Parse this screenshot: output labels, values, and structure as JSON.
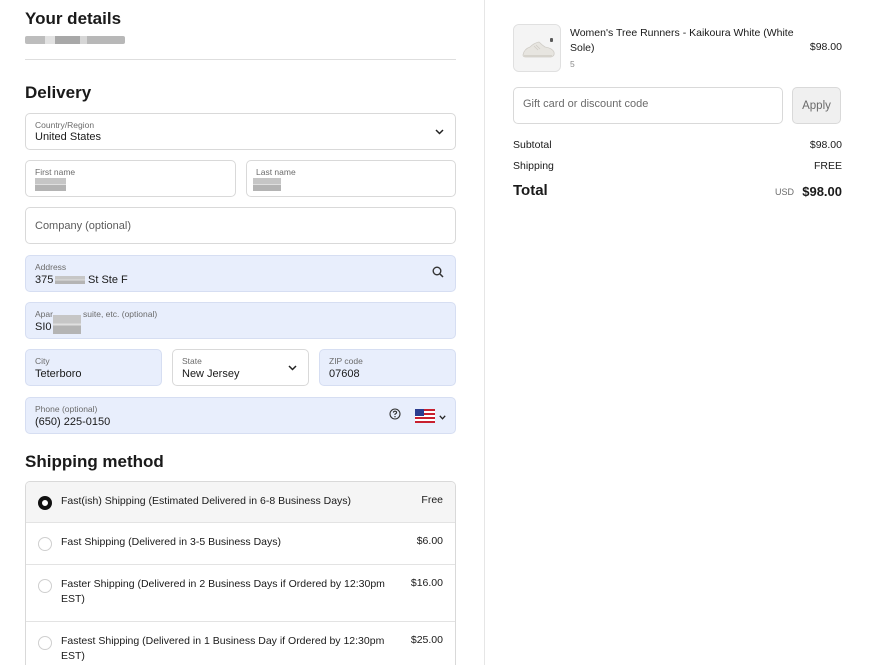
{
  "details": {
    "title": "Your details"
  },
  "delivery": {
    "title": "Delivery",
    "country": {
      "label": "Country/Region",
      "value": "United States"
    },
    "first_name": {
      "label": "First name"
    },
    "last_name": {
      "label": "Last name"
    },
    "company": {
      "placeholder": "Company (optional)"
    },
    "address": {
      "label": "Address",
      "value_prefix": "375",
      "value_suffix": "St Ste F"
    },
    "apartment": {
      "label_prefix": "Apar",
      "label_suffix": "suite, etc. (optional)",
      "value_prefix": "SI0"
    },
    "city": {
      "label": "City",
      "value": "Teterboro"
    },
    "state": {
      "label": "State",
      "value": "New Jersey"
    },
    "zip": {
      "label": "ZIP code",
      "value": "07608"
    },
    "phone": {
      "label": "Phone (optional)",
      "value": "(650) 225-0150",
      "country_flag": "us-flag-icon"
    }
  },
  "shipping": {
    "title": "Shipping method",
    "options": [
      {
        "label": "Fast(ish) Shipping (Estimated Delivered in 6-8 Business Days)",
        "price": "Free",
        "selected": true
      },
      {
        "label": "Fast Shipping (Delivered in 3-5 Business Days)",
        "price": "$6.00",
        "selected": false
      },
      {
        "label": "Faster Shipping (Delivered in 2 Business Days if Ordered by 12:30pm EST)",
        "price": "$16.00",
        "selected": false
      },
      {
        "label": "Fastest Shipping (Delivered in 1 Business Day if Ordered by 12:30pm EST)",
        "price": "$25.00",
        "selected": false
      }
    ]
  },
  "cart": {
    "item": {
      "name": "Women's Tree Runners - Kaikoura White (White Sole)",
      "size": "5",
      "price": "$98.00"
    },
    "discount_placeholder": "Gift card or discount code",
    "apply_label": "Apply",
    "subtotal_label": "Subtotal",
    "subtotal_value": "$98.00",
    "shipping_label": "Shipping",
    "shipping_value": "FREE",
    "total_label": "Total",
    "total_currency": "USD",
    "total_value": "$98.00"
  },
  "colors": {
    "autofill_bg": "#e8eefc",
    "border": "#d9d9d9",
    "text": "#1a1a1a"
  }
}
